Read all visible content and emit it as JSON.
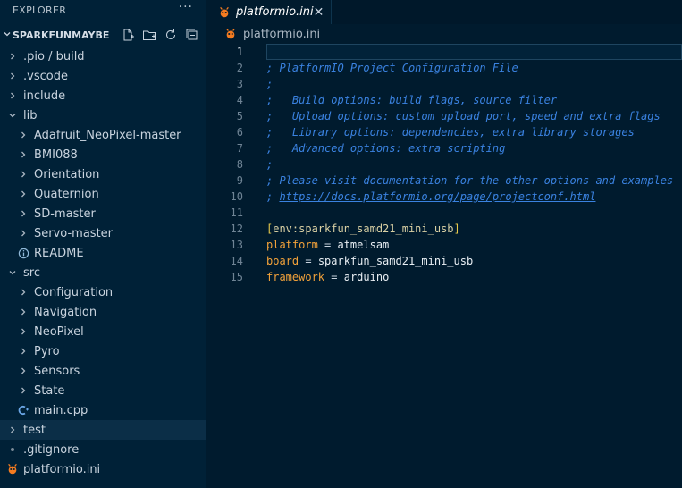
{
  "explorer": {
    "title": "EXPLORER",
    "more_label": "···",
    "project_name": "SPARKFUNMAYBE",
    "actions": [
      "new-file-icon",
      "new-folder-icon",
      "refresh-icon",
      "collapse-all-icon"
    ]
  },
  "tree": [
    {
      "label": ".pio / build",
      "depth": 0,
      "type": "folder",
      "expanded": false
    },
    {
      "label": ".vscode",
      "depth": 0,
      "type": "folder",
      "expanded": false
    },
    {
      "label": "include",
      "depth": 0,
      "type": "folder",
      "expanded": false
    },
    {
      "label": "lib",
      "depth": 0,
      "type": "folder",
      "expanded": true
    },
    {
      "label": "Adafruit_NeoPixel-master",
      "depth": 1,
      "type": "folder",
      "expanded": false
    },
    {
      "label": "BMI088",
      "depth": 1,
      "type": "folder",
      "expanded": false
    },
    {
      "label": "Orientation",
      "depth": 1,
      "type": "folder",
      "expanded": false
    },
    {
      "label": "Quaternion",
      "depth": 1,
      "type": "folder",
      "expanded": false
    },
    {
      "label": "SD-master",
      "depth": 1,
      "type": "folder",
      "expanded": false
    },
    {
      "label": "Servo-master",
      "depth": 1,
      "type": "folder",
      "expanded": false
    },
    {
      "label": "README",
      "depth": 1,
      "type": "readme"
    },
    {
      "label": "src",
      "depth": 0,
      "type": "folder",
      "expanded": true
    },
    {
      "label": "Configuration",
      "depth": 1,
      "type": "folder",
      "expanded": false
    },
    {
      "label": "Navigation",
      "depth": 1,
      "type": "folder",
      "expanded": false
    },
    {
      "label": "NeoPixel",
      "depth": 1,
      "type": "folder",
      "expanded": false
    },
    {
      "label": "Pyro",
      "depth": 1,
      "type": "folder",
      "expanded": false
    },
    {
      "label": "Sensors",
      "depth": 1,
      "type": "folder",
      "expanded": false
    },
    {
      "label": "State",
      "depth": 1,
      "type": "folder",
      "expanded": false
    },
    {
      "label": "main.cpp",
      "depth": 1,
      "type": "cpp"
    },
    {
      "label": "test",
      "depth": 0,
      "type": "folder",
      "expanded": false,
      "selected": true
    },
    {
      "label": ".gitignore",
      "depth": 0,
      "type": "gitignore"
    },
    {
      "label": "platformio.ini",
      "depth": 0,
      "type": "pio"
    }
  ],
  "tab": {
    "label": "platformio.ini",
    "close": "✕"
  },
  "breadcrumb": {
    "label": "platformio.ini"
  },
  "editor": {
    "current_line": 1,
    "lines": [
      {
        "n": "1",
        "tokens": []
      },
      {
        "n": "2",
        "tokens": [
          {
            "t": "; PlatformIO Project Configuration File",
            "c": "comment"
          }
        ]
      },
      {
        "n": "3",
        "tokens": [
          {
            "t": ";",
            "c": "comment"
          }
        ]
      },
      {
        "n": "4",
        "tokens": [
          {
            "t": ";   Build options: build flags, source filter",
            "c": "comment"
          }
        ]
      },
      {
        "n": "5",
        "tokens": [
          {
            "t": ";   Upload options: custom upload port, speed and extra flags",
            "c": "comment"
          }
        ]
      },
      {
        "n": "6",
        "tokens": [
          {
            "t": ";   Library options: dependencies, extra library storages",
            "c": "comment"
          }
        ]
      },
      {
        "n": "7",
        "tokens": [
          {
            "t": ";   Advanced options: extra scripting",
            "c": "comment"
          }
        ]
      },
      {
        "n": "8",
        "tokens": [
          {
            "t": ";",
            "c": "comment"
          }
        ]
      },
      {
        "n": "9",
        "tokens": [
          {
            "t": "; Please visit documentation for the other options and examples",
            "c": "comment"
          }
        ]
      },
      {
        "n": "10",
        "tokens": [
          {
            "t": "; ",
            "c": "comment"
          },
          {
            "t": "https://docs.platformio.org/page/projectconf.html",
            "c": "comment link"
          }
        ]
      },
      {
        "n": "11",
        "tokens": []
      },
      {
        "n": "12",
        "tokens": [
          {
            "t": "[",
            "c": "bracket"
          },
          {
            "t": "env:sparkfun_samd21_mini_usb",
            "c": "section"
          },
          {
            "t": "]",
            "c": "bracket"
          }
        ]
      },
      {
        "n": "13",
        "tokens": [
          {
            "t": "platform",
            "c": "key"
          },
          {
            "t": " = ",
            "c": "op"
          },
          {
            "t": "atmelsam",
            "c": "val"
          }
        ]
      },
      {
        "n": "14",
        "tokens": [
          {
            "t": "board",
            "c": "key"
          },
          {
            "t": " = ",
            "c": "op"
          },
          {
            "t": "sparkfun_samd21_mini_usb",
            "c": "val"
          }
        ]
      },
      {
        "n": "15",
        "tokens": [
          {
            "t": "framework",
            "c": "key"
          },
          {
            "t": " = ",
            "c": "op"
          },
          {
            "t": "arduino",
            "c": "val"
          }
        ]
      }
    ]
  },
  "colors": {
    "accent": "#f47b20",
    "comment": "#3a82e0",
    "key": "#f3a23a"
  }
}
